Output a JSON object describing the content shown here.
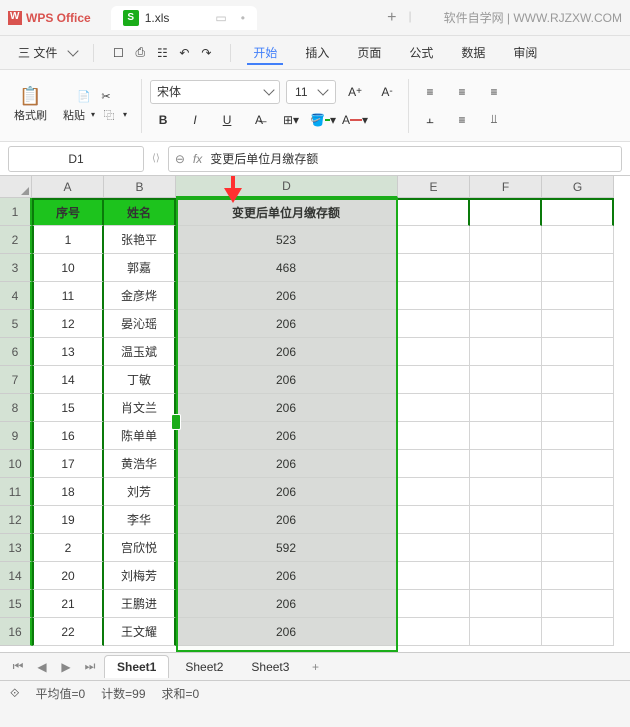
{
  "app": {
    "name": "WPS Office",
    "tab_file": "1.xls",
    "watermark": "软件自学网 | WWW.RJZXW.COM"
  },
  "menubar": {
    "file": "三 文件",
    "start": "开始",
    "insert": "插入",
    "page": "页面",
    "formula": "公式",
    "data": "数据",
    "review": "审阅"
  },
  "ribbon": {
    "format_brush": "格式刷",
    "paste": "粘贴",
    "font_name": "宋体",
    "font_size": "11",
    "bold": "B",
    "italic": "I",
    "underline": "U"
  },
  "fx": {
    "cell_ref": "D1",
    "fx_label": "fx",
    "value": "变更后单位月缴存额"
  },
  "columns": [
    "A",
    "B",
    "D",
    "E",
    "F",
    "G"
  ],
  "col_widths": {
    "A": 72,
    "B": 72,
    "D": 222,
    "E": 72,
    "F": 72,
    "G": 72
  },
  "headers": {
    "A": "序号",
    "B": "姓名",
    "D": "变更后单位月缴存额"
  },
  "rows": [
    {
      "n": 1,
      "a": "1",
      "b": "张艳平",
      "d": "523"
    },
    {
      "n": 2,
      "a": "10",
      "b": "郭嘉",
      "d": "468"
    },
    {
      "n": 3,
      "a": "11",
      "b": "金彦烨",
      "d": "206"
    },
    {
      "n": 4,
      "a": "12",
      "b": "晏沁瑶",
      "d": "206"
    },
    {
      "n": 5,
      "a": "13",
      "b": "温玉斌",
      "d": "206"
    },
    {
      "n": 6,
      "a": "14",
      "b": "丁敏",
      "d": "206"
    },
    {
      "n": 7,
      "a": "15",
      "b": "肖文兰",
      "d": "206"
    },
    {
      "n": 8,
      "a": "16",
      "b": "陈单单",
      "d": "206"
    },
    {
      "n": 9,
      "a": "17",
      "b": "黄浩华",
      "d": "206"
    },
    {
      "n": 10,
      "a": "18",
      "b": "刘芳",
      "d": "206"
    },
    {
      "n": 11,
      "a": "19",
      "b": "李华",
      "d": "206"
    },
    {
      "n": 12,
      "a": "2",
      "b": "宫欣悦",
      "d": "592"
    },
    {
      "n": 13,
      "a": "20",
      "b": "刘梅芳",
      "d": "206"
    },
    {
      "n": 14,
      "a": "21",
      "b": "王鹏进",
      "d": "206"
    },
    {
      "n": 15,
      "a": "22",
      "b": "王文耀",
      "d": "206"
    }
  ],
  "sheets": [
    "Sheet1",
    "Sheet2",
    "Sheet3"
  ],
  "status": {
    "avg_label": "平均值=0",
    "count_label": "计数=99",
    "sum_label": "求和=0"
  }
}
